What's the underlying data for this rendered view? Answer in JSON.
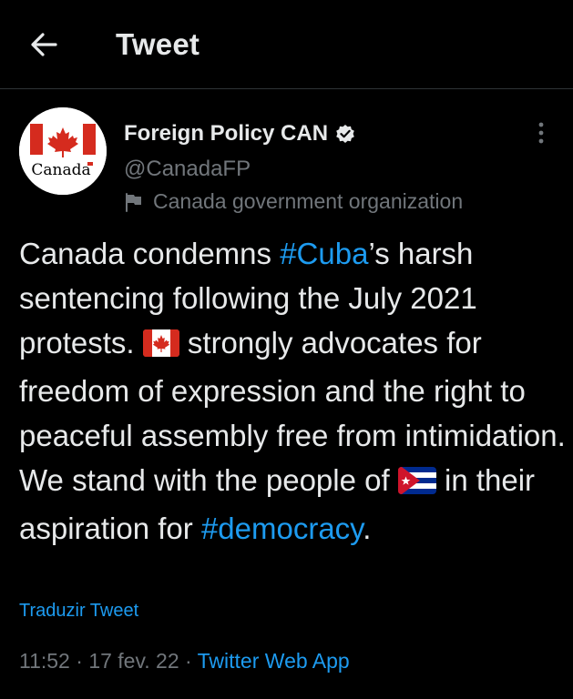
{
  "header": {
    "title": "Tweet"
  },
  "author": {
    "display_name": "Foreign Policy CAN",
    "handle": "@CanadaFP",
    "label": "Canada government organization",
    "avatar_text": "Canada"
  },
  "tweet": {
    "part1": "Canada condemns ",
    "hashtag1": "#Cuba",
    "part2": "’s harsh sentencing following the July 2021 protests. ",
    "part3": " strongly advocates for freedom of expression and the right to peaceful assembly free from intimidation. We stand with the people of ",
    "part4": " in their aspiration for ",
    "hashtag2": "#democracy",
    "part5": ".",
    "emoji1": "flag-canada-emoji",
    "emoji2": "flag-cuba-emoji"
  },
  "translate_label": "Traduzir Tweet",
  "meta": {
    "time": "11:52",
    "sep1": " · ",
    "date": "17 fev. 22",
    "sep2": " · ",
    "source": "Twitter Web App"
  },
  "colors": {
    "background": "#000000",
    "text": "#e7e9ea",
    "muted": "#71767b",
    "accent": "#1d9bf0",
    "canada_red": "#d52b1e",
    "cuba_blue": "#002a8f"
  }
}
